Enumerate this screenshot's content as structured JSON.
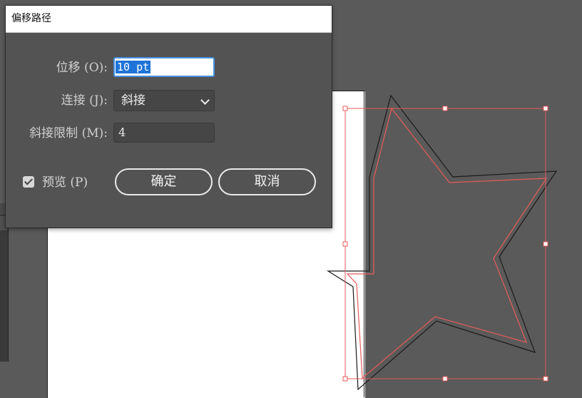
{
  "dialog": {
    "title": "偏移路径",
    "offset": {
      "label": "位移 (O):",
      "value": "10 pt"
    },
    "joins": {
      "label": "连接 (J):",
      "value": "斜接"
    },
    "miter_limit": {
      "label": "斜接限制 (M):",
      "value": "4"
    },
    "preview": {
      "label": "预览 (P)",
      "checked": true
    },
    "ok_label": "确定",
    "cancel_label": "取消"
  },
  "colors": {
    "canvas_bg": "#5a5a5a",
    "dialog_bg": "#535353",
    "selection": "#e85a5a",
    "path": "#1a1a1a",
    "input_focus": "#4a90e2",
    "text_selection": "#1e73d8"
  }
}
